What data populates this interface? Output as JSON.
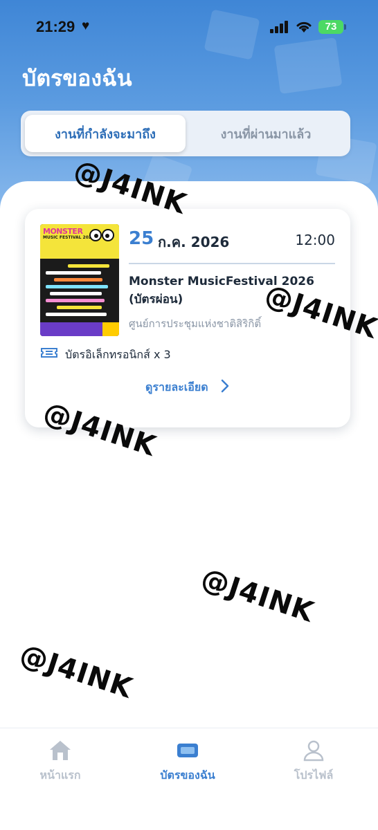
{
  "status_bar": {
    "time": "21:29",
    "heart": "♥",
    "battery": "73"
  },
  "header": {
    "title": "บัตรของฉัน"
  },
  "tabs": [
    {
      "label": "งานที่กำลังจะมาถึง",
      "active": true
    },
    {
      "label": "งานที่ผ่านมาแล้ว",
      "active": false
    }
  ],
  "ticket_card": {
    "poster_text": "MONSTER",
    "poster_sub": "MUSIC FESTIVAL 2026",
    "date_day": "25",
    "date_month_year": "ก.ค. 2026",
    "time": "12:00",
    "event_name": "Monster MusicFestival 2026 (บัตรผ่อน)",
    "venue": "ศูนย์การประชุมแห่งชาติสิริกิติ์",
    "ticket_type": "บัตรอิเล็กทรอนิกส์ x 3",
    "detail_label": "ดูรายละเอียด"
  },
  "bottom_nav": [
    {
      "label": "หน้าแรก",
      "icon": "home-icon",
      "active": false
    },
    {
      "label": "บัตรของฉัน",
      "icon": "ticket-icon",
      "active": true
    },
    {
      "label": "โปรไฟล์",
      "icon": "profile-icon",
      "active": false
    }
  ],
  "watermark": "@J4INK",
  "colors": {
    "accent": "#3b7fd0",
    "header_gradient_top": "#3f86d6",
    "battery": "#4cd964"
  }
}
